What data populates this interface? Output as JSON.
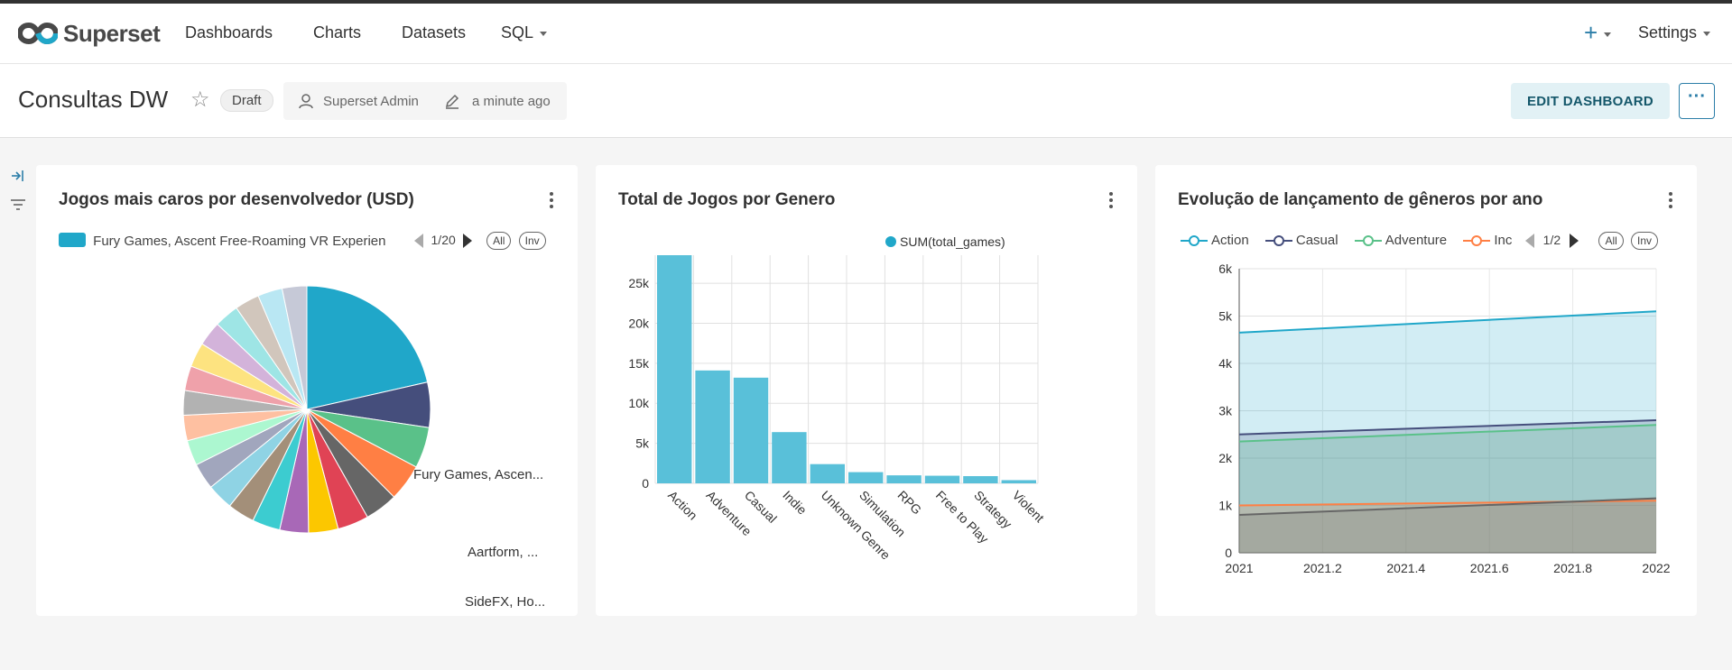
{
  "app": {
    "logo_text": "Superset",
    "nav": [
      "Dashboards",
      "Charts",
      "Datasets",
      "SQL"
    ],
    "add_label": "+",
    "settings_label": "Settings"
  },
  "dashboard": {
    "title": "Consultas DW",
    "status": "Draft",
    "owner": "Superset Admin",
    "modified": "a minute ago",
    "edit_label": "EDIT DASHBOARD",
    "more_label": "···"
  },
  "colors": {
    "brand": "#20a7c9",
    "accent": "#2c7ea8",
    "edit_bg": "#e2f1f5"
  },
  "chart_data": [
    {
      "type": "pie",
      "title": "Jogos mais caros por desenvolvedor (USD)",
      "legend_entry": "Fury Games, Ascent Free-Roaming VR Experien",
      "legend_page": "1/20",
      "legend_buttons": [
        "All",
        "Inv"
      ],
      "slice_labels": [
        "Fury Games, Ascen...",
        "Aartform, ...",
        "SideFX, Ho..."
      ],
      "values": [
        20,
        5.5,
        5,
        4.5,
        4,
        3.8,
        3.6,
        3.5,
        3.4,
        3.3,
        3.2,
        3.2,
        3.1,
        3.1,
        3.0,
        3.0,
        3.0,
        3.0,
        3.0,
        3.0,
        3.0,
        3.0
      ],
      "colors": [
        "#20a7c9",
        "#454e7c",
        "#5ac189",
        "#ff7f44",
        "#666666",
        "#e04355",
        "#fcc700",
        "#a868b7",
        "#3cccd0",
        "#a38f79",
        "#8fd3e4",
        "#a1a6bd",
        "#acf7d0",
        "#fec0a1",
        "#b2b2b2",
        "#efa1aa",
        "#fde380",
        "#d3b3da",
        "#9ee5e5",
        "#d1c6bc",
        "#b9e7f3",
        "#c6c9d7"
      ]
    },
    {
      "type": "bar",
      "title": "Total de Jogos por Genero",
      "legend": "SUM(total_games)",
      "categories": [
        "Action",
        "Adventure",
        "Casual",
        "Indie",
        "Unknown Genre",
        "Simulation",
        "RPG",
        "Free to Play",
        "Strategy",
        "Violent"
      ],
      "values": [
        28500,
        14100,
        13200,
        6400,
        2400,
        1400,
        1000,
        950,
        900,
        400
      ],
      "yticks": [
        "0",
        "5k",
        "10k",
        "15k",
        "20k",
        "25k"
      ],
      "ylim": [
        0,
        28500
      ],
      "color": "#59c0d9"
    },
    {
      "type": "area",
      "title": "Evolução de lançamento de gêneros por ano",
      "legend_names": [
        "Action",
        "Casual",
        "Adventure",
        "Inc"
      ],
      "legend_page": "1/2",
      "legend_buttons": [
        "All",
        "Inv"
      ],
      "x": [
        2021,
        2022
      ],
      "xticks": [
        "2021",
        "2021.2",
        "2021.4",
        "2021.6",
        "2021.8",
        "2022"
      ],
      "yticks": [
        "0",
        "1k",
        "2k",
        "3k",
        "4k",
        "5k",
        "6k"
      ],
      "ylim": [
        0,
        6000
      ],
      "series": [
        {
          "name": "Action",
          "values": [
            4650,
            5100
          ],
          "color": "#20a7c9"
        },
        {
          "name": "Casual",
          "values": [
            2500,
            2800
          ],
          "color": "#454e7c"
        },
        {
          "name": "Adventure",
          "values": [
            2350,
            2700
          ],
          "color": "#5ac189"
        },
        {
          "values": [
            1000,
            1100
          ],
          "color": "#ff7f44"
        },
        {
          "values": [
            800,
            1150
          ],
          "color": "#666666"
        }
      ]
    }
  ]
}
